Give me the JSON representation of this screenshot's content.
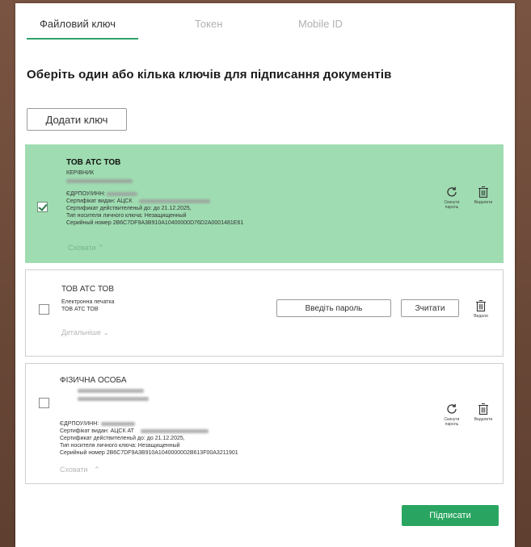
{
  "tabs": [
    {
      "label": "Файловий ключ",
      "active": true
    },
    {
      "label": "Токен",
      "active": false
    },
    {
      "label": "Mobile ID",
      "active": false
    }
  ],
  "title": "Оберіть один або кілька ключів для підписання документів",
  "add_key_label": "Додати ключ",
  "keys": [
    {
      "name": "ТОВ АТС ТОВ",
      "role": "КЕРІВНИК",
      "edrpou_label": "ЄДРПОУ/ИНН:",
      "cert_issuer": "Сертифікат видан: АЦСК",
      "cert_valid": "Сертификат действителеньй до: до 21.12.2025,",
      "carrier": "Тип носителя личного ключа: Незащищенный",
      "serial": "Серийный номер 2B6C7DF9A3B910A10400000D76D2A0001481E61",
      "toggle": "Сховати",
      "reset_label": "Скинути пароль",
      "delete_label": "Видалити",
      "selected": true
    },
    {
      "name": "ТОВ АТС ТОВ",
      "line1": "Електронна печатка",
      "line2": "ТОВ АТС ТОВ",
      "toggle": "Детальніше",
      "password_label": "Введіть пароль",
      "read_label": "Зчитати",
      "delete_label": "Видали",
      "selected": false
    },
    {
      "name": "ФІЗИЧНА ОСОБА",
      "edrpou_label": "ЄДРПОУ/ИНН:",
      "cert_issuer": "Сертифікат видан: АЦСК АТ",
      "cert_valid": "Сертификат действителеньй до: до 21.12.2025,",
      "carrier": "Тип носителя личного ключа: Незащищенный",
      "serial": "Серийный номер 2B6C7DF9A3B910A1040000002B613F00A3211901",
      "toggle": "Сховати",
      "reset_label": "Скинути пароль",
      "delete_label": "Видалити",
      "selected": false
    }
  ],
  "sign_label": "Підписати",
  "colors": {
    "accent": "#2aa561",
    "selected_bg": "#9fdcb1"
  }
}
